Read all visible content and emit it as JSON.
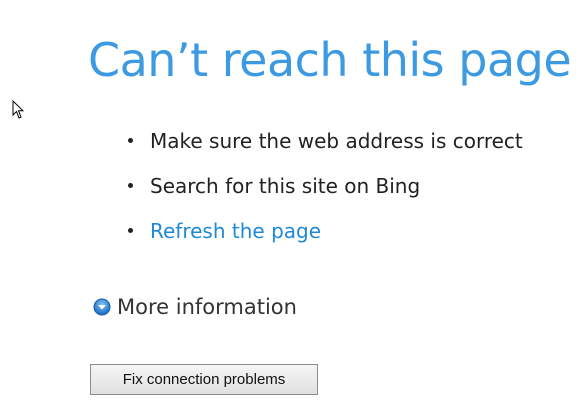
{
  "error": {
    "title": "Can’t reach this page",
    "suggestions": [
      {
        "label": "Make sure the web address is correct",
        "is_link": false
      },
      {
        "label": "Search for this site on Bing",
        "is_link": false
      },
      {
        "label": "Refresh the page",
        "is_link": true
      }
    ],
    "more_info_label": "More information",
    "fix_button_label": "Fix connection problems"
  },
  "icons": {
    "cursor": "mouse-pointer-icon",
    "more_info": "chevron-down-circle-icon"
  },
  "colors": {
    "title": "#3b9ae1",
    "link": "#1e8ad6",
    "text": "#222222",
    "chevron_circle": "#2a7fd4"
  }
}
